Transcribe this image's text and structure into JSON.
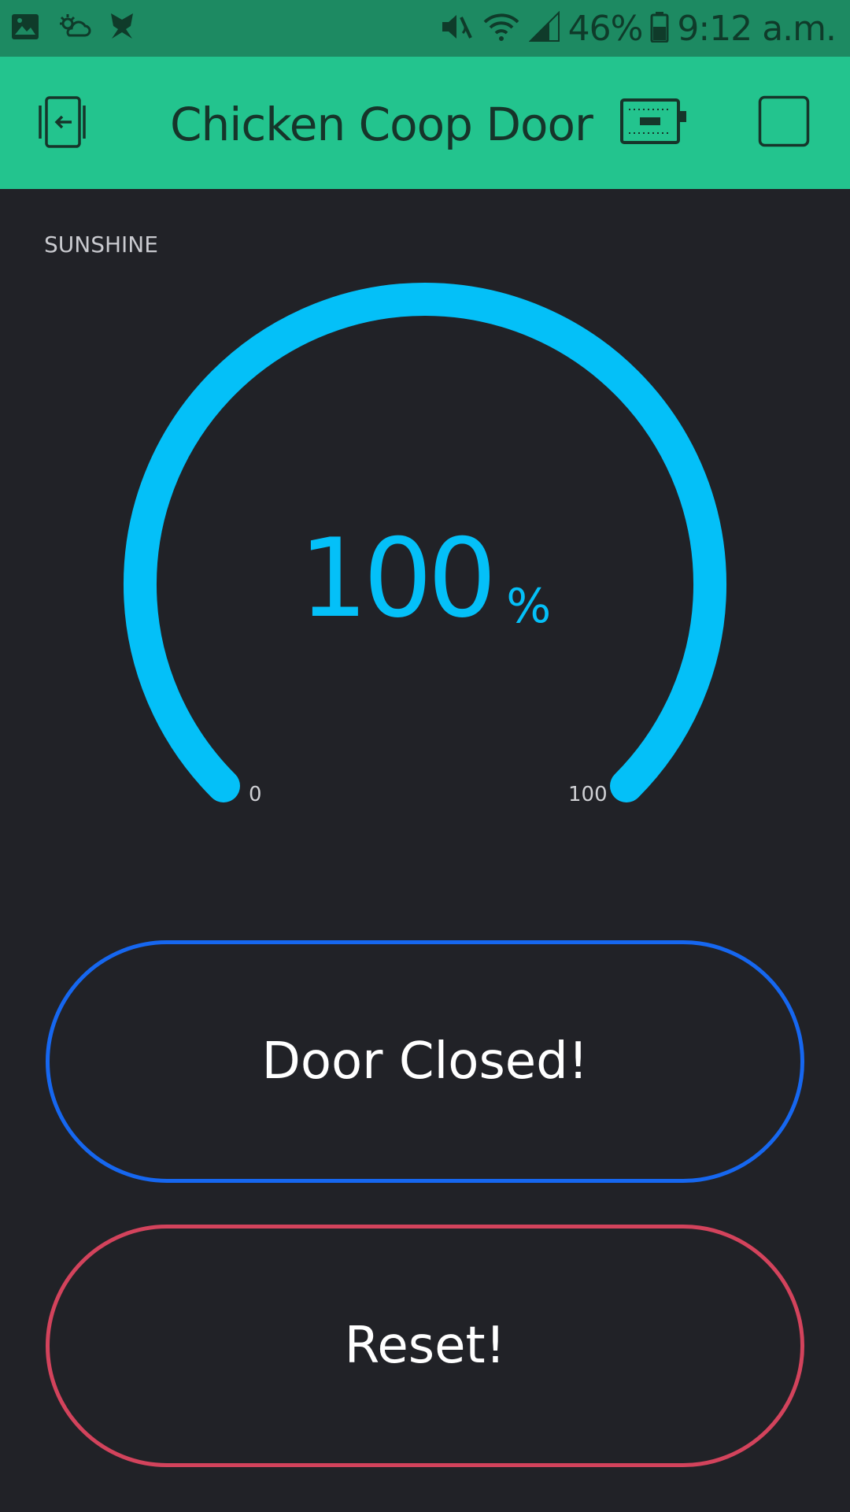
{
  "status_bar": {
    "battery_percent": "46%",
    "time": "9:12 a.m.",
    "icons": [
      "image-icon",
      "weather-icon",
      "butterfly-icon",
      "mute-icon",
      "wifi-icon",
      "signal-icon",
      "battery-icon"
    ]
  },
  "app_bar": {
    "title": "Chicken Coop Door",
    "icons": [
      "exit-icon",
      "device-icon",
      "stop-square-icon"
    ]
  },
  "gauge": {
    "label": "SUNSHINE",
    "value": "100",
    "unit": "%",
    "min_label": "0",
    "max_label": "100",
    "level": 1.0,
    "color": "#04c0f8"
  },
  "buttons": {
    "door_label": "Door Closed!",
    "door_color": "#1667f0",
    "reset_label": "Reset!",
    "reset_color": "#d3435c"
  },
  "colors": {
    "background": "#212227",
    "app_bar": "#23c48e",
    "status_bar": "#1d8a62"
  }
}
